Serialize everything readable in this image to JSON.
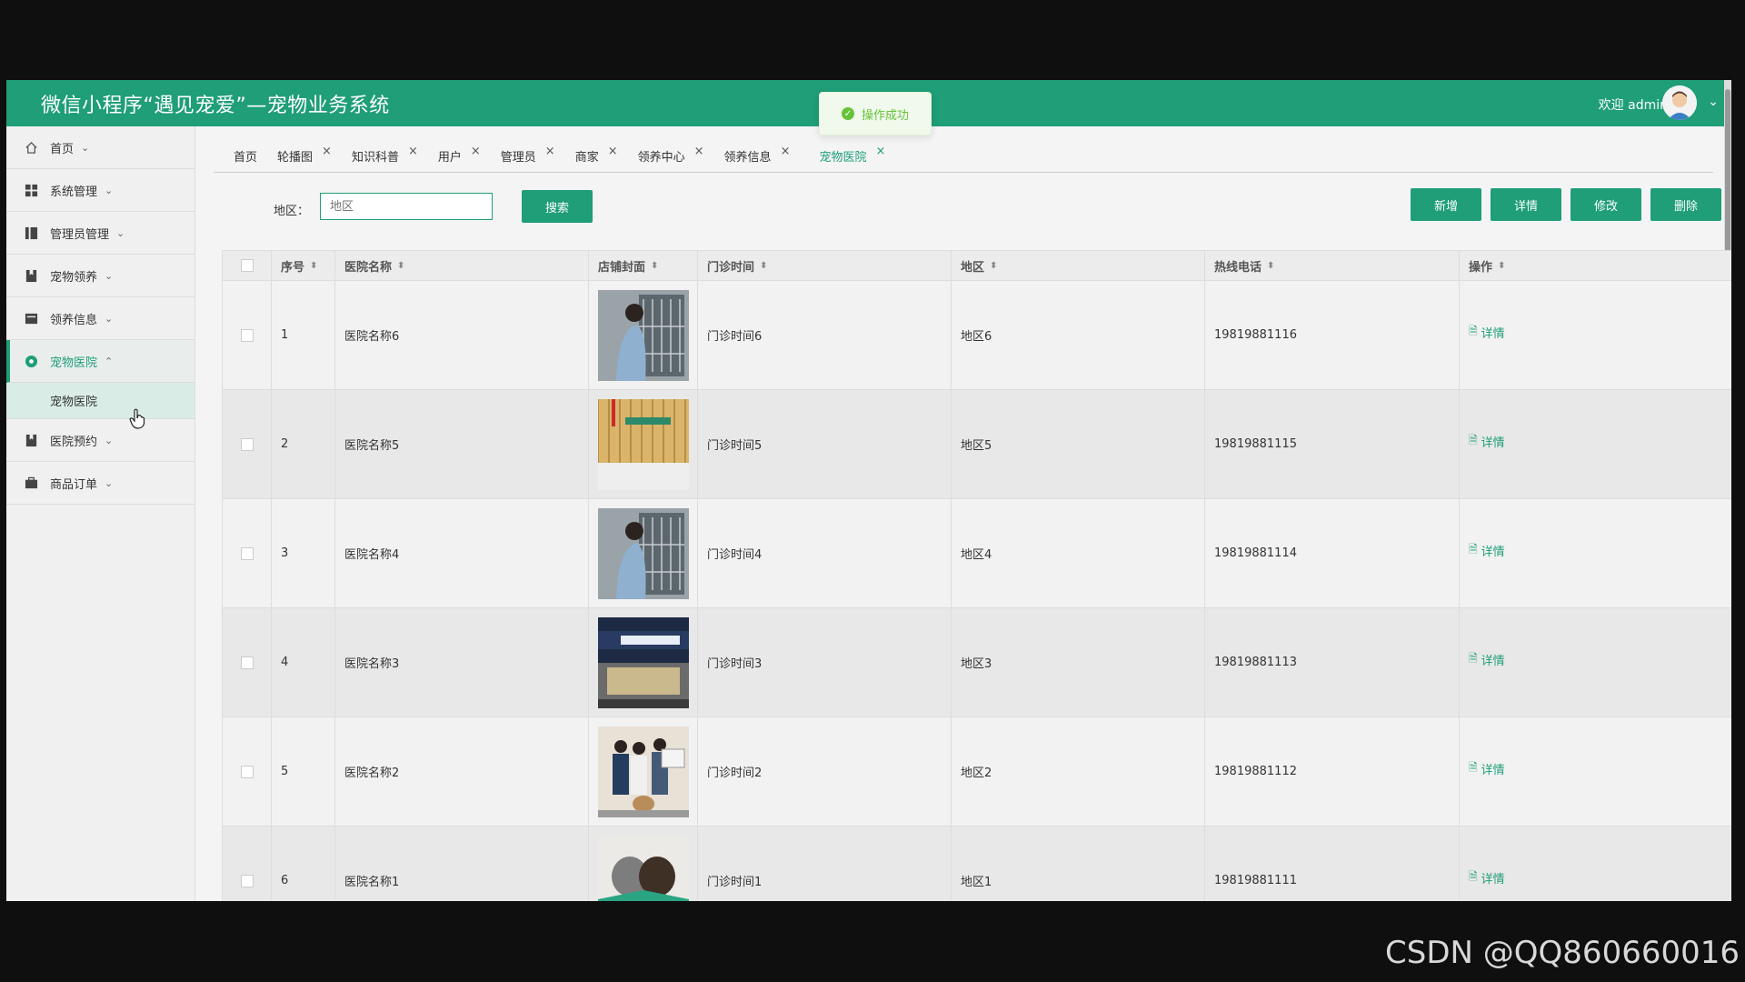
{
  "header": {
    "title": "微信小程序“遇见宠爱”—宠物业务系统",
    "welcome": "欢迎 admin"
  },
  "toast": {
    "text": "操作成功"
  },
  "sidebar": {
    "items": [
      {
        "label": "首页",
        "icon": "home-icon"
      },
      {
        "label": "系统管理",
        "icon": "grid-icon"
      },
      {
        "label": "管理员管理",
        "icon": "columns-icon"
      },
      {
        "label": "宠物领养",
        "icon": "bookmark-icon"
      },
      {
        "label": "领养信息",
        "icon": "card-icon"
      },
      {
        "label": "宠物医院",
        "icon": "circle-icon",
        "active": true
      },
      {
        "label": "医院预约",
        "icon": "bookmark-icon"
      },
      {
        "label": "商品订单",
        "icon": "briefcase-icon"
      }
    ],
    "submenu": [
      "宠物医院"
    ]
  },
  "tabs": [
    {
      "label": "首页",
      "closable": false
    },
    {
      "label": "轮播图",
      "closable": true
    },
    {
      "label": "知识科普",
      "closable": true
    },
    {
      "label": "用户",
      "closable": true
    },
    {
      "label": "管理员",
      "closable": true
    },
    {
      "label": "商家",
      "closable": true
    },
    {
      "label": "领养中心",
      "closable": true
    },
    {
      "label": "领养信息",
      "closable": true
    },
    {
      "label": "宠物医院",
      "closable": true,
      "active": true
    }
  ],
  "search": {
    "label": "地区：",
    "placeholder": "地区",
    "button": "搜索"
  },
  "actions": {
    "add": "新增",
    "detail": "详情",
    "edit": "修改",
    "delete": "删除"
  },
  "table": {
    "columns": [
      "序号",
      "医院名称",
      "店铺封面",
      "门诊时间",
      "地区",
      "热线电话",
      "操作"
    ],
    "detail_label": "详情",
    "rows": [
      {
        "no": "1",
        "name": "医院名称6",
        "time": "门诊时间6",
        "area": "地区6",
        "phone": "19819881116"
      },
      {
        "no": "2",
        "name": "医院名称5",
        "time": "门诊时间5",
        "area": "地区5",
        "phone": "19819881115"
      },
      {
        "no": "3",
        "name": "医院名称4",
        "time": "门诊时间4",
        "area": "地区4",
        "phone": "19819881114"
      },
      {
        "no": "4",
        "name": "医院名称3",
        "time": "门诊时间3",
        "area": "地区3",
        "phone": "19819881113"
      },
      {
        "no": "5",
        "name": "医院名称2",
        "time": "门诊时间2",
        "area": "地区2",
        "phone": "19819881112"
      },
      {
        "no": "6",
        "name": "医院名称1",
        "time": "门诊时间1",
        "area": "地区1",
        "phone": "19819881111"
      }
    ]
  },
  "watermark": "CSDN @QQ860660016",
  "colors": {
    "primary": "#1f9e78",
    "toast_green": "#67c23a"
  }
}
